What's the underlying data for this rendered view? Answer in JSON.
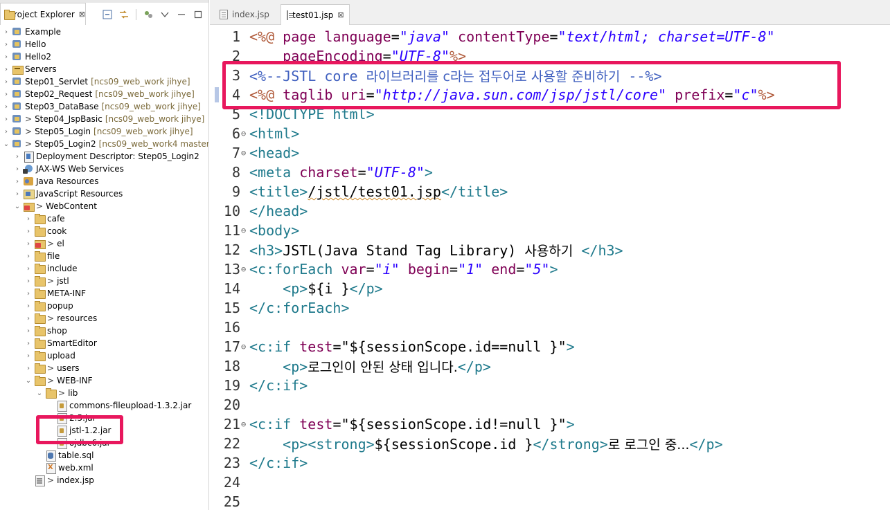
{
  "explorer": {
    "tab_label": "Project Explorer",
    "close_glyph": "⊠",
    "toolbar_icons": [
      "collapse-all-icon",
      "link-editor-icon",
      "filter-icon",
      "view-menu-icon",
      "minimize-icon",
      "maximize-icon"
    ],
    "items": [
      {
        "label": "Example",
        "decoration": "",
        "gt": false
      },
      {
        "label": "Hello",
        "decoration": "",
        "gt": false
      },
      {
        "label": "Hello2",
        "decoration": "",
        "gt": false
      },
      {
        "label": "Servers",
        "decoration": "",
        "gt": false
      },
      {
        "label": "Step01_Servlet",
        "decoration": "[ncs09_web_work jihye]",
        "gt": false
      },
      {
        "label": "Step02_Request",
        "decoration": "[ncs09_web_work jihye]",
        "gt": false
      },
      {
        "label": "Step03_DataBase",
        "decoration": "[ncs09_web_work jihye]",
        "gt": false
      },
      {
        "label": "Step04_JspBasic",
        "decoration": "[ncs09_web_work jihye]",
        "gt": true
      },
      {
        "label": "Step05_Login",
        "decoration": "[ncs09_web_work jihye]",
        "gt": true
      },
      {
        "label": "Step05_Login2",
        "decoration": "[ncs09_web_work4 master]",
        "gt": true
      },
      {
        "label": "Deployment Descriptor: Step05_Login2",
        "decoration": "",
        "gt": false
      },
      {
        "label": "JAX-WS Web Services",
        "decoration": "",
        "gt": false
      },
      {
        "label": "Java Resources",
        "decoration": "",
        "gt": false
      },
      {
        "label": "JavaScript Resources",
        "decoration": "",
        "gt": false
      },
      {
        "label": "WebContent",
        "decoration": "",
        "gt": true
      },
      {
        "label": "cafe",
        "decoration": "",
        "gt": false
      },
      {
        "label": "cook",
        "decoration": "",
        "gt": false
      },
      {
        "label": "el",
        "decoration": "",
        "gt": true
      },
      {
        "label": "file",
        "decoration": "",
        "gt": false
      },
      {
        "label": "include",
        "decoration": "",
        "gt": false
      },
      {
        "label": "jstl",
        "decoration": "",
        "gt": true
      },
      {
        "label": "META-INF",
        "decoration": "",
        "gt": false
      },
      {
        "label": "popup",
        "decoration": "",
        "gt": false
      },
      {
        "label": "resources",
        "decoration": "",
        "gt": true
      },
      {
        "label": "shop",
        "decoration": "",
        "gt": false
      },
      {
        "label": "SmartEditor",
        "decoration": "",
        "gt": false
      },
      {
        "label": "upload",
        "decoration": "",
        "gt": false
      },
      {
        "label": "users",
        "decoration": "",
        "gt": true
      },
      {
        "label": "WEB-INF",
        "decoration": "",
        "gt": true
      },
      {
        "label": "lib",
        "decoration": "",
        "gt": true
      },
      {
        "label": "commons-fileupload-1.3.2.jar",
        "decoration": "",
        "gt": false
      },
      {
        "label": "2.5.jar",
        "decoration": "",
        "gt": false
      },
      {
        "label": "jstl-1.2.jar",
        "decoration": "",
        "gt": false
      },
      {
        "label": "ojdbc6.jar",
        "decoration": "",
        "gt": false
      },
      {
        "label": "table.sql",
        "decoration": "",
        "gt": false
      },
      {
        "label": "web.xml",
        "decoration": "",
        "gt": false
      },
      {
        "label": "index.jsp",
        "decoration": "",
        "gt": true
      }
    ]
  },
  "editor": {
    "tabs": [
      {
        "label": "index.jsp",
        "active": false
      },
      {
        "label": "test01.jsp",
        "active": true
      }
    ],
    "close_glyph": "⊠",
    "fold_glyph": "⊖",
    "line_numbers": [
      "1",
      "2",
      "3",
      "4",
      "5",
      "6",
      "7",
      "8",
      "9",
      "10",
      "11",
      "12",
      "13",
      "14",
      "15",
      "16",
      "17",
      "18",
      "19",
      "20",
      "21",
      "22",
      "23",
      "24",
      "25"
    ],
    "lines": {
      "l1": [
        "<%@",
        " page ",
        "language",
        "=",
        "\"java\"",
        " ",
        "contentType",
        "=",
        "\"text/html; charset=UTF-8\""
      ],
      "l2": [
        "    ",
        "pageEncoding",
        "=",
        "\"UTF-8\"",
        "%>"
      ],
      "l3": [
        "<%--JSTL core ",
        "라이브러리를 c라는 접두어로 사용할 준비하기",
        " --%>"
      ],
      "l4": [
        "<%@",
        " taglib ",
        "uri",
        "=",
        "\"http://java.sun.com/jsp/jstl/core\"",
        " ",
        "prefix",
        "=",
        "\"c\"",
        "%>"
      ],
      "l5": [
        "<!DOCTYPE html>"
      ],
      "l6": [
        "<",
        "html",
        ">"
      ],
      "l7": [
        "<",
        "head",
        ">"
      ],
      "l8": [
        "<",
        "meta",
        " ",
        "charset",
        "=",
        "\"UTF-8\"",
        ">"
      ],
      "l9": [
        "<",
        "title",
        ">",
        "/jstl/test01.jsp",
        "</",
        "title",
        ">"
      ],
      "l10": [
        "</",
        "head",
        ">"
      ],
      "l11": [
        "<",
        "body",
        ">"
      ],
      "l12": [
        "<",
        "h3",
        ">",
        "JSTL(Java Stand Tag Library) ",
        "사용하기",
        " </",
        "h3",
        ">"
      ],
      "l13": [
        "<",
        "c:forEach",
        " ",
        "var",
        "=",
        "\"i\"",
        " ",
        "begin",
        "=",
        "\"1\"",
        " ",
        "end",
        "=",
        "\"5\"",
        ">"
      ],
      "l14": [
        "    ",
        "<",
        "p",
        ">",
        "${i }",
        "</",
        "p",
        ">"
      ],
      "l15": [
        "</",
        "c:forEach",
        ">"
      ],
      "l16": [],
      "l17": [
        "<",
        "c:if",
        " ",
        "test",
        "=",
        "\"",
        "${sessionScope.id==null }",
        "\"",
        ">"
      ],
      "l18": [
        "    ",
        "<",
        "p",
        ">",
        "로그인이 안된 상태 입니다.",
        "</",
        "p",
        ">"
      ],
      "l19": [
        "</",
        "c:if",
        ">"
      ],
      "l20": [],
      "l21": [
        "<",
        "c:if",
        " ",
        "test",
        "=",
        "\"",
        "${sessionScope.id!=null }",
        "\"",
        ">"
      ],
      "l22": [
        "    ",
        "<",
        "p",
        ">",
        "<",
        "strong",
        ">",
        "${sessionScope.id }",
        "</",
        "strong",
        ">",
        "로 로그인 중...",
        "</",
        "p",
        ">"
      ],
      "l23": [
        "</",
        "c:if",
        ">"
      ],
      "l24": [],
      "l25": []
    }
  },
  "colors": {
    "highlight": "#e8175d",
    "tag": "#1f7a8c",
    "attribute": "#7f0055",
    "string": "#2a00ff",
    "comment": "#3f5fbf",
    "jsp_delimiter": "#b05a3a"
  }
}
